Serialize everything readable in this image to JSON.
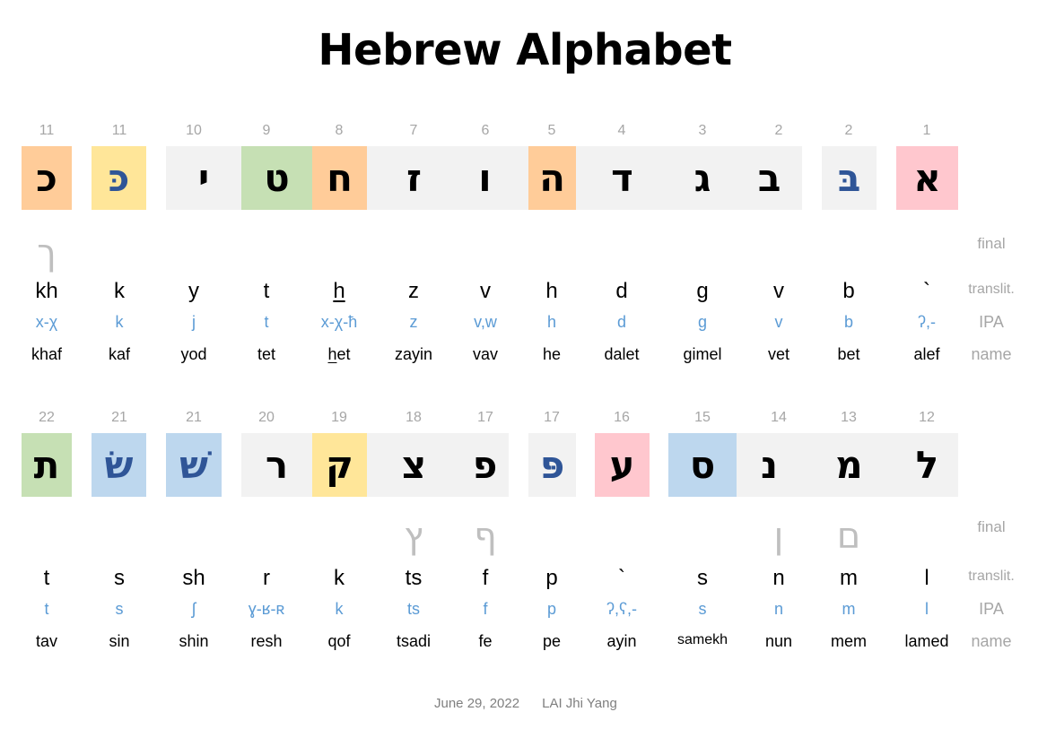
{
  "title": "Hebrew Alphabet",
  "row_labels": {
    "final": "final",
    "translit": "translit.",
    "ipa": "IPA",
    "name": "name"
  },
  "colors": {
    "gray": "#f2f2f2",
    "orange": "#ffcc99",
    "yellow": "#ffe699",
    "green": "#c6e0b4",
    "pink": "#ffc7ce",
    "blue": "#bdd7ee"
  },
  "rows": [
    {
      "letters": [
        {
          "num": "11",
          "char": "כ",
          "final": "ך",
          "translit": "kh",
          "ipa": "x-χ",
          "name": "khaf",
          "color": "orange",
          "dagesh": false
        },
        {
          "num": "11",
          "char": "כּ",
          "final": "",
          "translit": "k",
          "ipa": "k",
          "name": "kaf",
          "color": "yellow",
          "dagesh": true
        },
        {
          "num": "10",
          "char": "י",
          "final": "",
          "translit": "y",
          "ipa": "j",
          "name": "yod",
          "color": "gray",
          "dagesh": false
        },
        {
          "num": "9",
          "char": "ט",
          "final": "",
          "translit": "t",
          "ipa": "t",
          "name": "tet",
          "color": "green",
          "dagesh": false
        },
        {
          "num": "8",
          "char": "ח",
          "final": "",
          "translit": "h",
          "ipa": "x-χ-ħ",
          "name_pre": "h",
          "name": "et",
          "color": "orange",
          "dagesh": false,
          "underline": true
        },
        {
          "num": "7",
          "char": "ז",
          "final": "",
          "translit": "z",
          "ipa": "z",
          "name": "zayin",
          "color": "gray",
          "dagesh": false
        },
        {
          "num": "6",
          "char": "ו",
          "final": "",
          "translit": "v",
          "ipa": "v,w",
          "name": "vav",
          "color": "gray",
          "dagesh": false
        },
        {
          "num": "5",
          "char": "ה",
          "final": "",
          "translit": "h",
          "ipa": "h",
          "name": "he",
          "color": "orange",
          "dagesh": false
        },
        {
          "num": "4",
          "char": "ד",
          "final": "",
          "translit": "d",
          "ipa": "d",
          "name": "dalet",
          "color": "gray",
          "dagesh": false
        },
        {
          "num": "3",
          "char": "ג",
          "final": "",
          "translit": "g",
          "ipa": "g",
          "name": "gimel",
          "color": "gray",
          "dagesh": false
        },
        {
          "num": "2",
          "char": "ב",
          "final": "",
          "translit": "v",
          "ipa": "v",
          "name": "vet",
          "color": "gray",
          "dagesh": false
        },
        {
          "num": "2",
          "char": "בּ",
          "final": "",
          "translit": "b",
          "ipa": "b",
          "name": "bet",
          "color": "gray",
          "dagesh": true
        },
        {
          "num": "1",
          "char": "א",
          "final": "",
          "translit": "`",
          "ipa": "ʔ,-",
          "name": "alef",
          "color": "pink",
          "dagesh": false
        }
      ]
    },
    {
      "letters": [
        {
          "num": "22",
          "char": "ת",
          "final": "",
          "translit": "t",
          "ipa": "t",
          "name": "tav",
          "color": "green",
          "dagesh": false
        },
        {
          "num": "21",
          "char": "שׂ",
          "final": "",
          "translit": "s",
          "ipa": "s",
          "name": "sin",
          "color": "blue",
          "dagesh": true
        },
        {
          "num": "21",
          "char": "שׁ",
          "final": "",
          "translit": "sh",
          "ipa": "ʃ",
          "name": "shin",
          "color": "blue",
          "dagesh": true
        },
        {
          "num": "20",
          "char": "ר",
          "final": "",
          "translit": "r",
          "ipa": "ɣ-ʁ-ʀ",
          "name": "resh",
          "color": "gray",
          "dagesh": false
        },
        {
          "num": "19",
          "char": "ק",
          "final": "",
          "translit": "k",
          "ipa": "k",
          "name": "qof",
          "color": "yellow",
          "dagesh": false
        },
        {
          "num": "18",
          "char": "צ",
          "final": "ץ",
          "translit": "ts",
          "ipa": "ts",
          "name": "tsadi",
          "color": "gray",
          "dagesh": false
        },
        {
          "num": "17",
          "char": "פ",
          "final": "ף",
          "translit": "f",
          "ipa": "f",
          "name": "fe",
          "color": "gray",
          "dagesh": false
        },
        {
          "num": "17",
          "char": "פּ",
          "final": "",
          "translit": "p",
          "ipa": "p",
          "name": "pe",
          "color": "gray",
          "dagesh": true
        },
        {
          "num": "16",
          "char": "ע",
          "final": "",
          "translit": "`",
          "ipa": "ʔ,ʕ,-",
          "name": "ayin",
          "color": "pink",
          "dagesh": false
        },
        {
          "num": "15",
          "char": "ס",
          "final": "",
          "translit": "s",
          "ipa": "s",
          "name": "samekh",
          "color": "blue",
          "dagesh": false
        },
        {
          "num": "14",
          "char": "נ",
          "final": "ן",
          "translit": "n",
          "ipa": "n",
          "name": "nun",
          "color": "gray",
          "dagesh": false
        },
        {
          "num": "13",
          "char": "מ",
          "final": "ם",
          "translit": "m",
          "ipa": "m",
          "name": "mem",
          "color": "gray",
          "dagesh": false
        },
        {
          "num": "12",
          "char": "ל",
          "final": "",
          "translit": "l",
          "ipa": "l",
          "name": "lamed",
          "color": "gray",
          "dagesh": false
        }
      ]
    }
  ],
  "footer": {
    "date": "June 29, 2022",
    "author": "LAI Jhi Yang"
  }
}
